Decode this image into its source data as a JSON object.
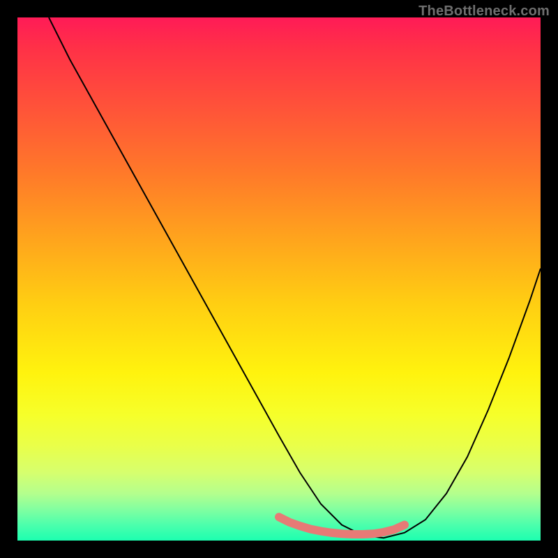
{
  "watermark": {
    "text": "TheBottleneck.com"
  },
  "chart_data": {
    "type": "line",
    "title": "",
    "xlabel": "",
    "ylabel": "",
    "xlim": [
      0,
      100
    ],
    "ylim": [
      0,
      100
    ],
    "background": {
      "type": "vertical-gradient",
      "stops": [
        {
          "pos": 0,
          "color": "#ff1b57"
        },
        {
          "pos": 6,
          "color": "#ff3147"
        },
        {
          "pos": 18,
          "color": "#ff5538"
        },
        {
          "pos": 30,
          "color": "#ff7a29"
        },
        {
          "pos": 42,
          "color": "#ffa31d"
        },
        {
          "pos": 55,
          "color": "#ffcf12"
        },
        {
          "pos": 68,
          "color": "#fff30e"
        },
        {
          "pos": 76,
          "color": "#f6ff2a"
        },
        {
          "pos": 82,
          "color": "#e9ff4a"
        },
        {
          "pos": 87,
          "color": "#d6ff6e"
        },
        {
          "pos": 91,
          "color": "#b4ff8d"
        },
        {
          "pos": 94,
          "color": "#82ffa0"
        },
        {
          "pos": 97,
          "color": "#4cffac"
        },
        {
          "pos": 100,
          "color": "#1cffb0"
        }
      ]
    },
    "series": [
      {
        "name": "bottleneck-curve",
        "color": "#000000",
        "width": 2,
        "x": [
          6,
          10,
          15,
          20,
          25,
          30,
          35,
          40,
          45,
          50,
          54,
          58,
          62,
          66,
          70,
          74,
          78,
          82,
          86,
          90,
          94,
          98,
          100
        ],
        "y": [
          100,
          92,
          83,
          74,
          65,
          56,
          47,
          38,
          29,
          20,
          13,
          7,
          3,
          1,
          0.5,
          1.5,
          4,
          9,
          16,
          25,
          35,
          46,
          52
        ]
      },
      {
        "name": "optimal-range",
        "color": "#e77a76",
        "width": 12,
        "linecap": "round",
        "x": [
          50,
          52,
          54,
          56,
          58,
          60,
          62,
          64,
          66,
          68,
          70,
          72,
          74
        ],
        "y": [
          4.5,
          3.5,
          2.8,
          2.2,
          1.8,
          1.5,
          1.3,
          1.2,
          1.2,
          1.3,
          1.6,
          2.1,
          3.0
        ]
      }
    ]
  }
}
